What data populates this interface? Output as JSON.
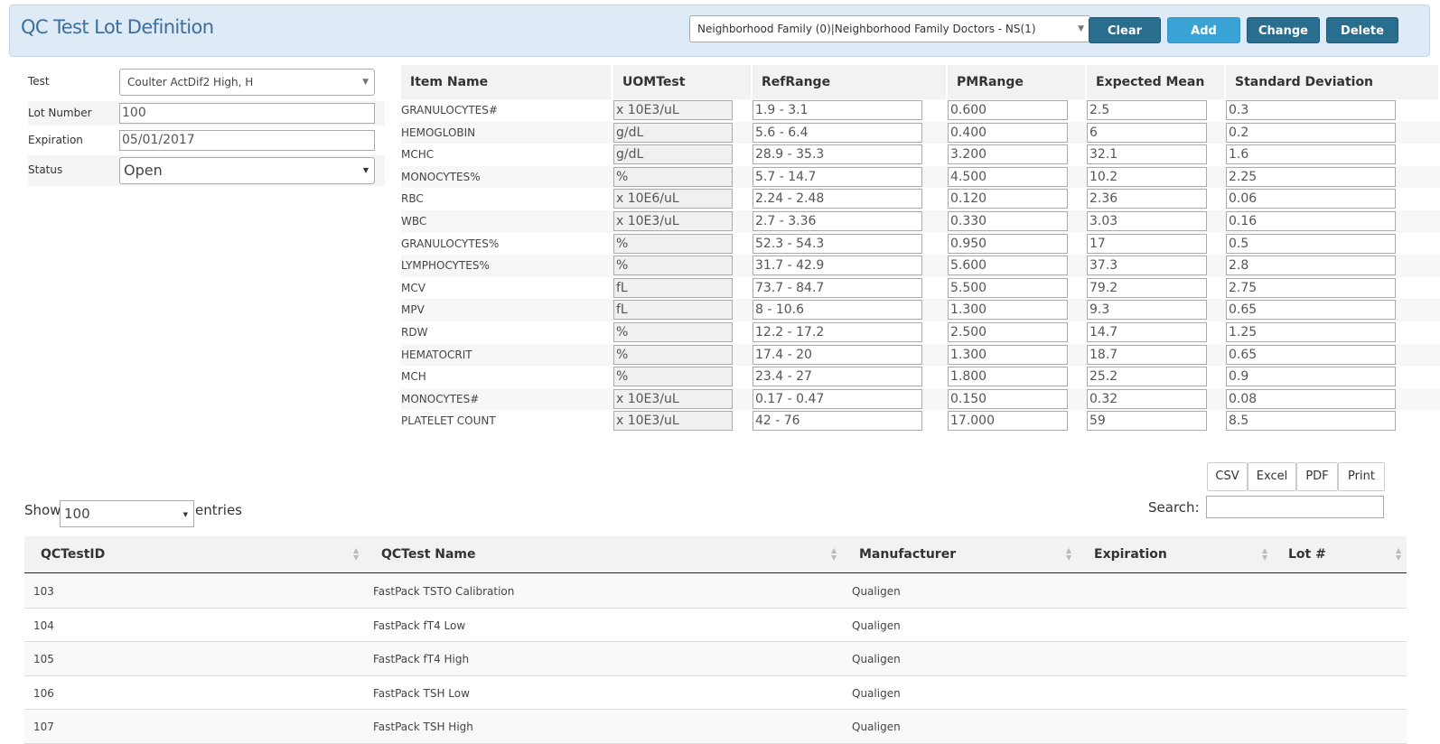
{
  "header": {
    "title": "QC Test Lot Definition",
    "practice_select": "Neighborhood Family (0)|Neighborhood Family Doctors - NS(1)",
    "buttons": {
      "clear": "Clear",
      "add": "Add",
      "change": "Change",
      "delete": "Delete"
    }
  },
  "form": {
    "test_label": "Test",
    "test_value": "Coulter ActDif2 High, H",
    "lot_label": "Lot Number",
    "lot_value": "100",
    "expiration_label": "Expiration",
    "expiration_value": "05/01/2017",
    "status_label": "Status",
    "status_value": "Open"
  },
  "items": {
    "columns": [
      "Item Name",
      "UOMTest",
      "RefRange",
      "PMRange",
      "Expected Mean",
      "Standard Deviation"
    ],
    "rows": [
      {
        "name": "GRANULOCYTES#",
        "uom": "x 10E3/uL",
        "ref": "1.9 - 3.1",
        "pm": "0.600",
        "mean": "2.5",
        "sd": "0.3"
      },
      {
        "name": "HEMOGLOBIN",
        "uom": "g/dL",
        "ref": "5.6 - 6.4",
        "pm": "0.400",
        "mean": "6",
        "sd": "0.2"
      },
      {
        "name": "MCHC",
        "uom": "g/dL",
        "ref": "28.9 - 35.3",
        "pm": "3.200",
        "mean": "32.1",
        "sd": "1.6"
      },
      {
        "name": "MONOCYTES%",
        "uom": "%",
        "ref": "5.7 - 14.7",
        "pm": "4.500",
        "mean": "10.2",
        "sd": "2.25"
      },
      {
        "name": "RBC",
        "uom": "x 10E6/uL",
        "ref": "2.24 - 2.48",
        "pm": "0.120",
        "mean": "2.36",
        "sd": "0.06"
      },
      {
        "name": "WBC",
        "uom": "x 10E3/uL",
        "ref": "2.7 - 3.36",
        "pm": "0.330",
        "mean": "3.03",
        "sd": "0.16"
      },
      {
        "name": "GRANULOCYTES%",
        "uom": "%",
        "ref": "52.3 - 54.3",
        "pm": "0.950",
        "mean": "17",
        "sd": "0.5"
      },
      {
        "name": "LYMPHOCYTES%",
        "uom": "%",
        "ref": "31.7 - 42.9",
        "pm": "5.600",
        "mean": "37.3",
        "sd": "2.8"
      },
      {
        "name": "MCV",
        "uom": "fL",
        "ref": "73.7 - 84.7",
        "pm": "5.500",
        "mean": "79.2",
        "sd": "2.75"
      },
      {
        "name": "MPV",
        "uom": "fL",
        "ref": "8 - 10.6",
        "pm": "1.300",
        "mean": "9.3",
        "sd": "0.65"
      },
      {
        "name": "RDW",
        "uom": "%",
        "ref": "12.2 - 17.2",
        "pm": "2.500",
        "mean": "14.7",
        "sd": "1.25"
      },
      {
        "name": "HEMATOCRIT",
        "uom": "%",
        "ref": "17.4 - 20",
        "pm": "1.300",
        "mean": "18.7",
        "sd": "0.65"
      },
      {
        "name": "MCH",
        "uom": "%",
        "ref": "23.4 - 27",
        "pm": "1.800",
        "mean": "25.2",
        "sd": "0.9"
      },
      {
        "name": "MONOCYTES#",
        "uom": "x 10E3/uL",
        "ref": "0.17 - 0.47",
        "pm": "0.150",
        "mean": "0.32",
        "sd": "0.08"
      },
      {
        "name": "PLATELET COUNT",
        "uom": "x 10E3/uL",
        "ref": "42 - 76",
        "pm": "17.000",
        "mean": "59",
        "sd": "8.5"
      }
    ]
  },
  "export_buttons": {
    "csv": "CSV",
    "excel": "Excel",
    "pdf": "PDF",
    "print": "Print"
  },
  "list": {
    "show_label": "Show",
    "show_value": "100",
    "entries_label": "entries",
    "search_label": "Search:",
    "columns": [
      "QCTestID",
      "QCTest Name",
      "Manufacturer",
      "Expiration",
      "Lot #"
    ],
    "rows": [
      {
        "id": "103",
        "name": "FastPack TSTO Calibration",
        "manufacturer": "Qualigen",
        "expiration": "",
        "lot": ""
      },
      {
        "id": "104",
        "name": "FastPack fT4 Low",
        "manufacturer": "Qualigen",
        "expiration": "",
        "lot": ""
      },
      {
        "id": "105",
        "name": "FastPack fT4 High",
        "manufacturer": "Qualigen",
        "expiration": "",
        "lot": ""
      },
      {
        "id": "106",
        "name": "FastPack TSH Low",
        "manufacturer": "Qualigen",
        "expiration": "",
        "lot": ""
      },
      {
        "id": "107",
        "name": "FastPack TSH High",
        "manufacturer": "Qualigen",
        "expiration": "",
        "lot": ""
      }
    ]
  }
}
